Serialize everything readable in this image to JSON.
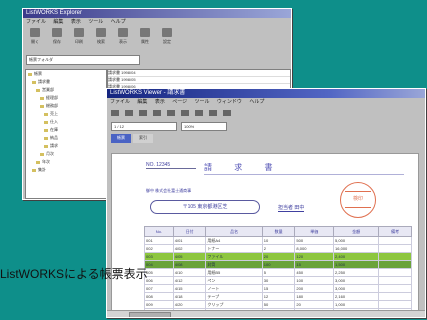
{
  "caption": "ListWORKSによる帳票表示",
  "explorer": {
    "title": "ListWORKS Explorer",
    "menu": [
      "ファイル",
      "編集",
      "表示",
      "ツール",
      "ヘルプ"
    ],
    "toolbar": [
      {
        "label": "開く",
        "icon": "folder-icon"
      },
      {
        "label": "保存",
        "icon": "save-icon"
      },
      {
        "label": "印刷",
        "icon": "print-icon"
      },
      {
        "label": "検索",
        "icon": "search-icon"
      },
      {
        "label": "表示",
        "icon": "view-icon"
      },
      {
        "label": "属性",
        "icon": "properties-icon"
      },
      {
        "label": "設定",
        "icon": "settings-icon"
      }
    ],
    "address": "帳票フォルダ",
    "tree": [
      "帳票",
      "請求書",
      "営業部",
      "経理部",
      "総務部",
      "売上",
      "仕入",
      "在庫",
      "納品",
      "請求",
      "月次",
      "年次",
      "集計"
    ],
    "list_rows": [
      "請求書 1998/04",
      "請求書 1998/05",
      "請求書 1998/06",
      "請求書 1998/07"
    ]
  },
  "viewer": {
    "title": "ListWORKS Viewer - 請求書",
    "menu": [
      "ファイル",
      "編集",
      "表示",
      "ページ",
      "ツール",
      "ウィンドウ",
      "ヘルプ"
    ],
    "page_field": "1 / 12",
    "zoom_field": "100%",
    "tabs": [
      "帳票",
      "索引"
    ],
    "doc": {
      "code": "NO. 12345",
      "title": "請 求 書",
      "customer": "御中 株式会社富士通商事",
      "address": "〒105 東京都港区芝",
      "rep": "担当者 田中",
      "seal": "検印"
    },
    "table": {
      "headers": [
        "No.",
        "日付",
        "品名",
        "数量",
        "単価",
        "金額",
        "備考"
      ],
      "rows": [
        [
          "001",
          "4/01",
          "用紙A4",
          "10",
          "500",
          "5,000",
          ""
        ],
        [
          "002",
          "4/02",
          "トナー",
          "2",
          "8,000",
          "16,000",
          ""
        ],
        [
          "003",
          "4/05",
          "ファイル",
          "20",
          "120",
          "2,400",
          ""
        ],
        [
          "004",
          "4/08",
          "封筒",
          "100",
          "15",
          "1,500",
          ""
        ],
        [
          "005",
          "4/10",
          "用紙B5",
          "5",
          "450",
          "2,250",
          ""
        ],
        [
          "006",
          "4/12",
          "ペン",
          "30",
          "100",
          "3,000",
          ""
        ],
        [
          "007",
          "4/15",
          "ノート",
          "15",
          "200",
          "3,000",
          ""
        ],
        [
          "008",
          "4/18",
          "テープ",
          "12",
          "180",
          "2,160",
          ""
        ],
        [
          "009",
          "4/20",
          "クリップ",
          "50",
          "20",
          "1,000",
          ""
        ],
        [
          "010",
          "4/22",
          "付箋",
          "40",
          "80",
          "3,200",
          ""
        ],
        [
          "011",
          "4/25",
          "のり",
          "10",
          "150",
          "1,500",
          ""
        ],
        [
          "012",
          "4/28",
          "はさみ",
          "3",
          "600",
          "1,800",
          ""
        ]
      ],
      "highlight_rows": [
        2,
        3
      ]
    }
  }
}
